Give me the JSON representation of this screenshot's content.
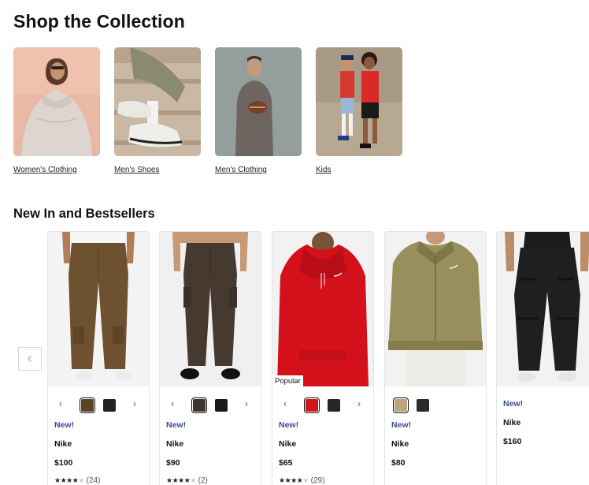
{
  "section1": {
    "title": "Shop the Collection",
    "items": [
      {
        "label": "Women's Clothing"
      },
      {
        "label": "Men's Shoes"
      },
      {
        "label": "Men's Clothing"
      },
      {
        "label": "Kids"
      }
    ]
  },
  "section2": {
    "title": "New In and Bestsellers",
    "products": [
      {
        "tag": "New!",
        "brand": "Nike",
        "price": "$100",
        "rating_count": "(24)",
        "stars": 4,
        "swatches": [
          "#5a4226",
          "#222222"
        ],
        "selected_swatch": 0
      },
      {
        "tag": "New!",
        "brand": "Nike",
        "price": "$90",
        "rating_count": "(2)",
        "stars": 4,
        "swatches": [
          "#3e3430",
          "#1a1a1a"
        ],
        "selected_swatch": 0
      },
      {
        "tag": "New!",
        "brand": "Nike",
        "price": "$65",
        "rating_count": "(29)",
        "stars": 4.5,
        "badge": "Popular",
        "swatches": [
          "#d0161d",
          "#262626"
        ],
        "selected_swatch": 0
      },
      {
        "tag": "New!",
        "brand": "Nike",
        "price": "$80",
        "swatches": [
          "#b9a67b",
          "#2a2a2a"
        ],
        "selected_swatch": 0
      },
      {
        "tag": "New!",
        "brand": "Nike",
        "price": "$160"
      }
    ]
  },
  "icons": {
    "prev": "chevron-left-icon",
    "swatch_prev": "chevron-left-icon",
    "swatch_next": "chevron-right-icon"
  }
}
